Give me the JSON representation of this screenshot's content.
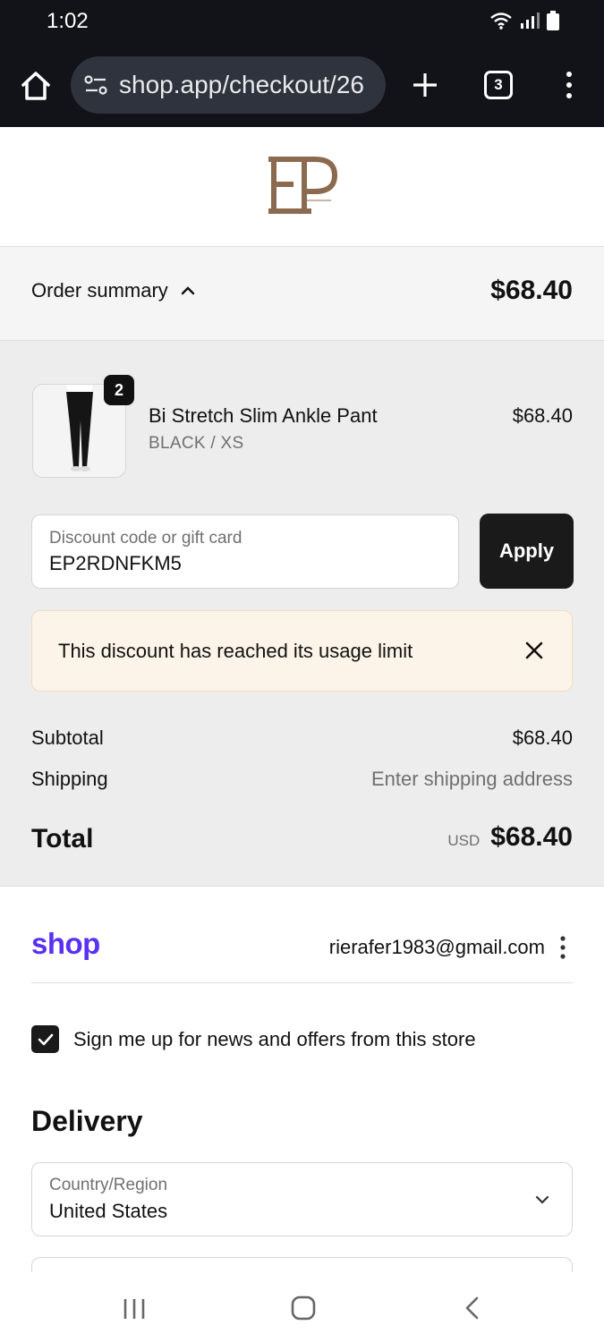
{
  "status_bar": {
    "time": "1:02"
  },
  "browser": {
    "url": "shop.app/checkout/26",
    "tab_count": "3"
  },
  "order_summary": {
    "toggle_label": "Order summary",
    "total": "$68.40"
  },
  "product": {
    "quantity": "2",
    "name": "Bi Stretch Slim Ankle Pant",
    "variant": "BLACK / XS",
    "price": "$68.40"
  },
  "discount": {
    "label": "Discount code or gift card",
    "value": "EP2RDNFKM5",
    "apply_label": "Apply"
  },
  "alert": {
    "message": "This discount has reached its usage limit"
  },
  "totals": {
    "subtotal_label": "Subtotal",
    "subtotal_value": "$68.40",
    "shipping_label": "Shipping",
    "shipping_value": "Enter shipping address",
    "total_label": "Total",
    "currency": "USD",
    "total_value": "$68.40"
  },
  "shop_pay": {
    "logo_text": "shop",
    "email": "rierafer1983@gmail.com"
  },
  "newsletter": {
    "label": "Sign me up for news and offers from this store",
    "checked": true
  },
  "delivery": {
    "heading": "Delivery",
    "country_label": "Country/Region",
    "country_value": "United States"
  },
  "colors": {
    "brand_logo": "#8b6a4f",
    "shop_purple": "#5a31f4",
    "button_dark": "#1a1a1a",
    "alert_bg": "#fdf4e9"
  }
}
